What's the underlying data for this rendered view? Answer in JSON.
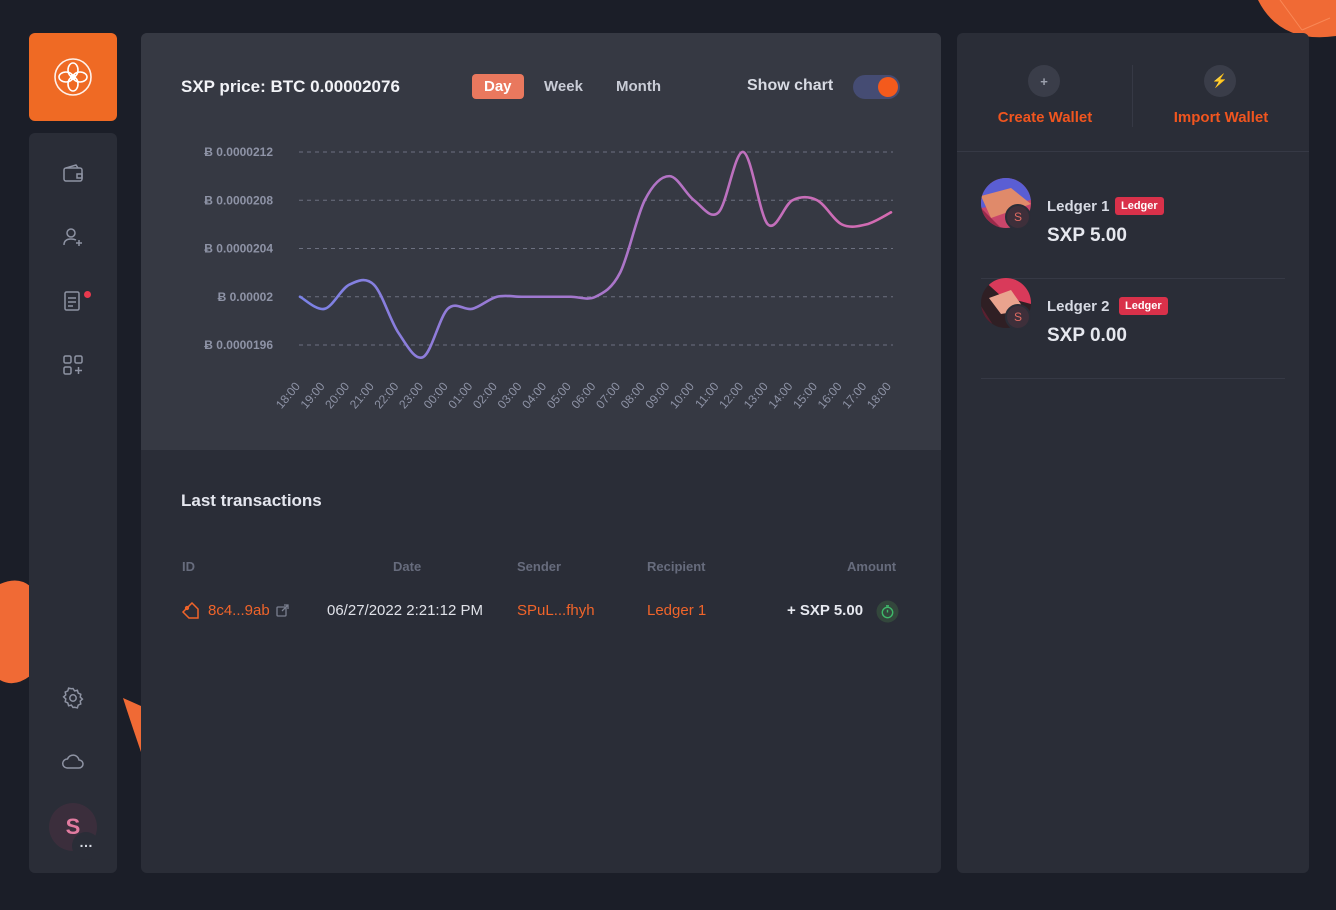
{
  "sidebar": {
    "icons": [
      "logo-icon",
      "wallet-icon",
      "contacts-icon",
      "transactions-icon",
      "plugins-icon",
      "settings-icon",
      "cloud-icon"
    ],
    "avatar_letter": "S",
    "avatar_more": "…"
  },
  "chart_header": {
    "title": "SXP price: BTC 0.00002076",
    "tabs": [
      "Day",
      "Week",
      "Month"
    ],
    "active_tab": "Day",
    "show_chart_label": "Show chart",
    "show_chart_on": true
  },
  "chart_data": {
    "type": "line",
    "title": "",
    "x": [
      "18:00",
      "19:00",
      "20:00",
      "21:00",
      "22:00",
      "23:00",
      "00:00",
      "01:00",
      "02:00",
      "03:00",
      "04:00",
      "05:00",
      "06:00",
      "07:00",
      "08:00",
      "09:00",
      "10:00",
      "11:00",
      "12:00",
      "13:00",
      "14:00",
      "15:00",
      "16:00",
      "17:00",
      "18:00"
    ],
    "series": [
      {
        "values": [
          2e-05,
          1.99e-05,
          2.01e-05,
          2.01e-05,
          1.97e-05,
          1.95e-05,
          1.99e-05,
          1.99e-05,
          2e-05,
          2e-05,
          2e-05,
          2e-05,
          2e-05,
          2.02e-05,
          2.08e-05,
          2.1e-05,
          2.08e-05,
          2.07e-05,
          2.12e-05,
          2.06e-05,
          2.08e-05,
          2.08e-05,
          2.06e-05,
          2.06e-05,
          2.07e-05
        ]
      }
    ],
    "y_ticks": [
      "Ƀ 0.0000212",
      "Ƀ 0.0000208",
      "Ƀ 0.0000204",
      "Ƀ 0.00002",
      "Ƀ 0.0000196"
    ],
    "y_tick_values": [
      2.12e-05,
      2.08e-05,
      2.04e-05,
      2e-05,
      1.96e-05
    ],
    "ylim": [
      1.96e-05,
      2.12e-05
    ],
    "grid": true,
    "color_start": "#7b82e6",
    "color_end": "#d56ab0"
  },
  "transactions": {
    "title": "Last transactions",
    "columns": {
      "id": "ID",
      "date": "Date",
      "sender": "Sender",
      "recipient": "Recipient",
      "amount": "Amount"
    },
    "rows": [
      {
        "id": "8c4...9ab",
        "date": "06/27/2022 2:21:12 PM",
        "sender": "SPuL...fhyh",
        "recipient": "Ledger 1",
        "amount": "+ SXP 5.00"
      }
    ]
  },
  "wallet_panel": {
    "create_label": "Create Wallet",
    "create_icon": "+",
    "import_label": "Import Wallet",
    "import_icon": "⚡",
    "wallets": [
      {
        "name": "Ledger 1",
        "badge": "Ledger",
        "balance": "SXP 5.00",
        "mini": "S"
      },
      {
        "name": "Ledger 2",
        "badge": "Ledger",
        "balance": "SXP 0.00",
        "mini": "S"
      }
    ]
  },
  "colors": {
    "accent": "#ef6a24",
    "background": "#1b1e28",
    "panel": "#2a2d37",
    "badge": "#d9314a"
  }
}
